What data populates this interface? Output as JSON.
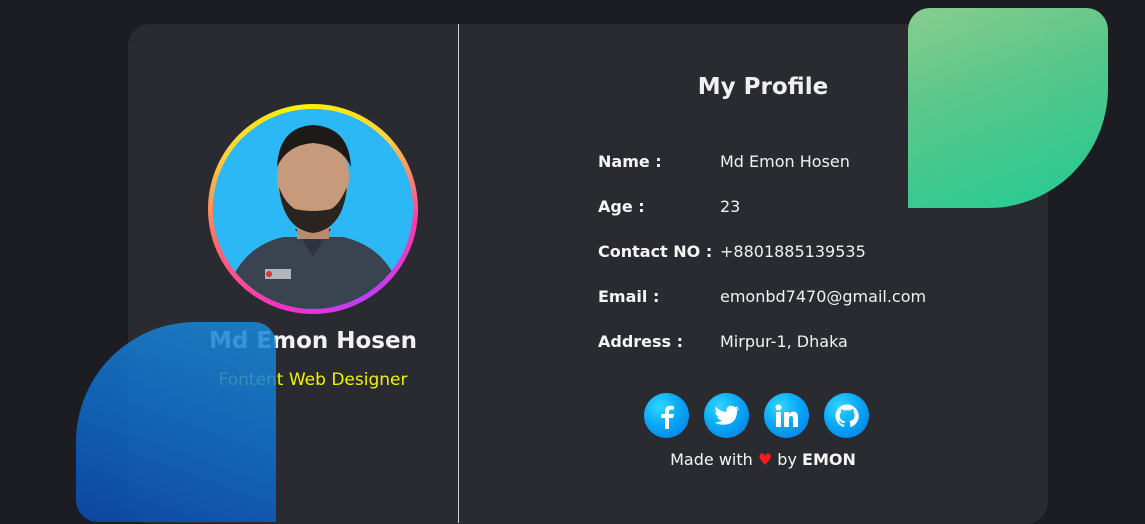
{
  "left_panel": {
    "name": "Md Emon Hosen",
    "role": "Fontent Web Designer"
  },
  "right_panel": {
    "title": "My Profile",
    "rows": [
      {
        "label": "Name :",
        "value": "Md Emon Hosen"
      },
      {
        "label": "Age :",
        "value": "23"
      },
      {
        "label": "Contact NO :",
        "value": "+8801885139535"
      },
      {
        "label": "Email :",
        "value": "emonbd7470@gmail.com"
      },
      {
        "label": "Address :",
        "value": "Mirpur-1, Dhaka"
      }
    ]
  },
  "social_links": [
    {
      "icon": "facebook-icon"
    },
    {
      "icon": "twitter-icon"
    },
    {
      "icon": "linkedin-icon"
    },
    {
      "icon": "github-icon"
    }
  ],
  "footer": {
    "made_with": "Made with",
    "heart": "♥",
    "by": "by",
    "author": "EMON"
  },
  "colors": {
    "background": "#1c1d23",
    "card": "#2a2b31",
    "role_text": "#f2f200",
    "social_blue": "#0aa8f5",
    "heart": "#ff1a1a",
    "green_blob": "#20d39a",
    "blue_blob": "#0f6ccd"
  }
}
